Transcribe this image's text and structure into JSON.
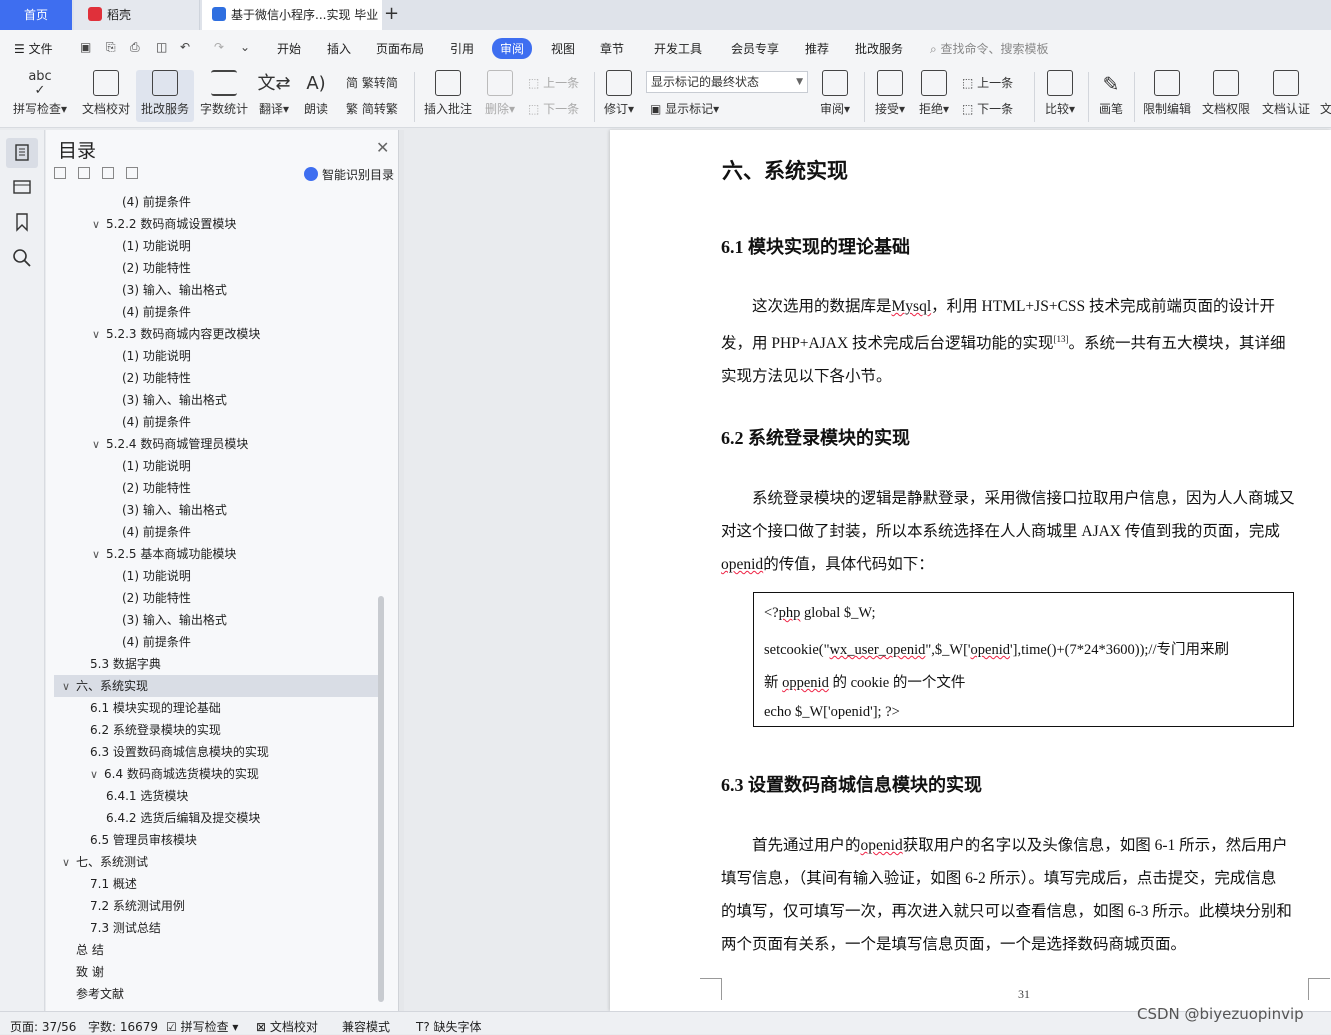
{
  "tabs": {
    "home": "首页",
    "daoke": "稻壳",
    "doc": "基于微信小程序...实现 毕业"
  },
  "menu": {
    "file": "文件",
    "items": [
      "开始",
      "插入",
      "页面布局",
      "引用",
      "审阅",
      "视图",
      "章节",
      "开发工具",
      "会员专享",
      "推荐",
      "批改服务"
    ],
    "active": "审阅",
    "search": "查找命令、搜索模板"
  },
  "ribbon": {
    "spell": "拼写检查",
    "spell_abc": "abc",
    "proof": "文档校对",
    "correct": "批改服务",
    "wordcount": "字数统计",
    "translate": "翻译",
    "read": "朗读",
    "trad": "繁转简",
    "simp": "简转繁",
    "insert_comment": "插入批注",
    "delete": "删除",
    "prev": "上一条",
    "next": "下一条",
    "revise": "修订",
    "markstate": "显示标记的最终状态",
    "showmark": "显示标记",
    "review": "审阅",
    "accept": "接受",
    "reject": "拒绝",
    "prev2": "上一条",
    "next2": "下一条",
    "compare": "比较",
    "pen": "画笔",
    "restrict": "限制编辑",
    "perm": "文档权限",
    "cert": "文档认证",
    "more": "文"
  },
  "toc": {
    "title": "目录",
    "smart": "智能识别目录",
    "items": [
      {
        "text": "(4)  前提条件",
        "level": 3,
        "chev": ""
      },
      {
        "text": "5.2.2  数码商城设置模块",
        "level": 2,
        "chev": "∨"
      },
      {
        "text": "(1)  功能说明",
        "level": 3,
        "chev": ""
      },
      {
        "text": "(2)  功能特性",
        "level": 3,
        "chev": ""
      },
      {
        "text": "(3)  输入、输出格式",
        "level": 3,
        "chev": ""
      },
      {
        "text": "(4)  前提条件",
        "level": 3,
        "chev": ""
      },
      {
        "text": "5.2.3  数码商城内容更改模块",
        "level": 2,
        "chev": "∨"
      },
      {
        "text": "(1)  功能说明",
        "level": 3,
        "chev": ""
      },
      {
        "text": "(2)  功能特性",
        "level": 3,
        "chev": ""
      },
      {
        "text": "(3)  输入、输出格式",
        "level": 3,
        "chev": ""
      },
      {
        "text": "(4)  前提条件",
        "level": 3,
        "chev": ""
      },
      {
        "text": "5.2.4  数码商城管理员模块",
        "level": 2,
        "chev": "∨"
      },
      {
        "text": "(1)  功能说明",
        "level": 3,
        "chev": ""
      },
      {
        "text": "(2)  功能特性",
        "level": 3,
        "chev": ""
      },
      {
        "text": "(3)  输入、输出格式",
        "level": 3,
        "chev": ""
      },
      {
        "text": "(4)  前提条件",
        "level": 3,
        "chev": ""
      },
      {
        "text": "5.2.5  基本商城功能模块",
        "level": 2,
        "chev": "∨"
      },
      {
        "text": "(1)  功能说明",
        "level": 3,
        "chev": ""
      },
      {
        "text": "(2)  功能特性",
        "level": 3,
        "chev": ""
      },
      {
        "text": "(3)  输入、输出格式",
        "level": 3,
        "chev": ""
      },
      {
        "text": "(4)  前提条件",
        "level": 3,
        "chev": ""
      },
      {
        "text": "5.3  数据字典",
        "level": 1,
        "chev": ""
      },
      {
        "text": "六、系统实现",
        "level": 0,
        "chev": "∨",
        "selected": true
      },
      {
        "text": "6.1  模块实现的理论基础",
        "level": 1,
        "chev": ""
      },
      {
        "text": "6.2  系统登录模块的实现",
        "level": 1,
        "chev": ""
      },
      {
        "text": "6.3  设置数码商城信息模块的实现",
        "level": 1,
        "chev": ""
      },
      {
        "text": "6.4  数码商城选货模块的实现",
        "level": 1,
        "chev": "∨"
      },
      {
        "text": "6.4.1  选货模块",
        "level": 2,
        "chev": ""
      },
      {
        "text": "6.4.2  选货后编辑及提交模块",
        "level": 2,
        "chev": ""
      },
      {
        "text": "6.5  管理员审核模块",
        "level": 1,
        "chev": ""
      },
      {
        "text": "七、系统测试",
        "level": 0,
        "chev": "∨"
      },
      {
        "text": "7.1  概述",
        "level": 1,
        "chev": ""
      },
      {
        "text": "7.2  系统测试用例",
        "level": 1,
        "chev": ""
      },
      {
        "text": "7.3  测试总结",
        "level": 1,
        "chev": ""
      },
      {
        "text": "总    结",
        "level": -1,
        "chev": ""
      },
      {
        "text": "致    谢",
        "level": -1,
        "chev": ""
      },
      {
        "text": "参考文献",
        "level": -1,
        "chev": ""
      }
    ]
  },
  "document": {
    "h1": "六、系统实现",
    "s61": "6.1  模块实现的理论基础",
    "p1_l1a": "这次选用的数据库是",
    "p1_mysql": "Mysql",
    "p1_l1b": "，利用 HTML+JS+CSS 技术完成前端页面的设计开",
    "p1_l2a": "发，用 PHP+AJAX 技术完成后台逻辑功能的实现",
    "p1_ref": "[13]",
    "p1_l2b": "。系统一共有五大模块，其详细",
    "p1_l3": "实现方法见以下各小节。",
    "s62": "6.2  系统登录模块的实现",
    "p2_l1": "系统登录模块的逻辑是静默登录，采用微信接口拉取用户信息，因为人人商城又",
    "p2_l2": "对这个接口做了封装，所以本系统选择在人人商城里 AJAX 传值到我的页面，完成",
    "p2_openid": "openid",
    "p2_l3": "的传值，具体代码如下：",
    "code_l1a": "<?",
    "code_php": "php",
    "code_l1b": "    global $_W;",
    "code_l2a": "setcookie(\"",
    "code_l2u": "wx_user_openid",
    "code_l2b": "\",$_W['",
    "code_l2o": "openid",
    "code_l2c": "'],time()+(7*24*3600));//专门用来刷",
    "code_l3a": "新 ",
    "code_l3u": "oppenid",
    "code_l3b": " 的 cookie 的一个文件",
    "code_l4": "echo $_W['openid'];    ?>",
    "s63": "6.3  设置数码商城信息模块的实现",
    "p3_l1a": "首先通过用户的",
    "p3_openid": "openid",
    "p3_l1b": "获取用户的名字以及头像信息，如图 6-1 所示，然后用户",
    "p3_l2": "填写信息，（其间有输入验证，如图 6-2 所示）。填写完成后，点击提交，完成信息",
    "p3_l3": "的填写，仅可填写一次，再次进入就只可以查看信息，如图 6-3 所示。此模块分别和",
    "p3_l4": "两个页面有关系，一个是填写信息页面，一个是选择数码商城页面。",
    "pagenum": "31"
  },
  "status": {
    "page": "页面: 37/56",
    "words": "字数: 16679",
    "spell": "拼写检查",
    "proof": "文档校对",
    "compat": "兼容模式",
    "missing": "缺失字体"
  },
  "watermark": "CSDN @biyezuopinvip",
  "colors": {
    "accent": "#3e6ef0",
    "selection": "#d9dde5"
  }
}
